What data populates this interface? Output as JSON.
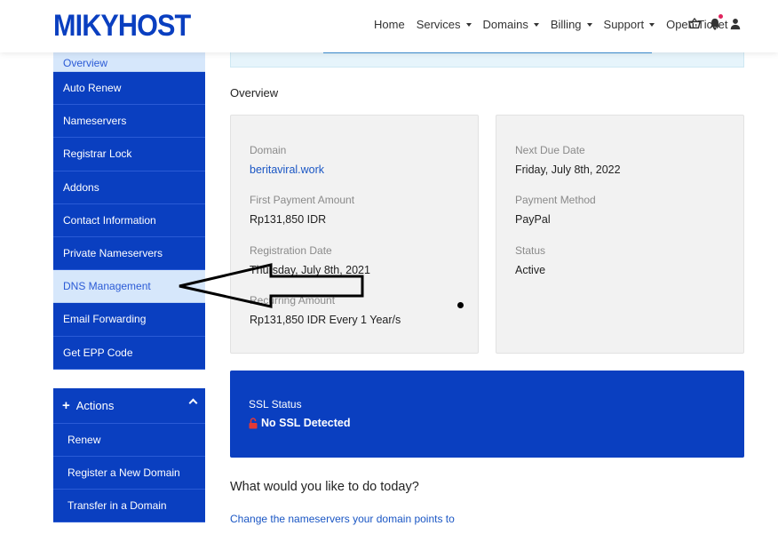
{
  "header": {
    "logo": "MIKYHOST",
    "nav": [
      {
        "label": "Home",
        "dropdown": false
      },
      {
        "label": "Services",
        "dropdown": true
      },
      {
        "label": "Domains",
        "dropdown": true
      },
      {
        "label": "Billing",
        "dropdown": true
      },
      {
        "label": "Support",
        "dropdown": true
      },
      {
        "label": "Open Ticket",
        "dropdown": false
      }
    ],
    "icons": [
      "cart-icon",
      "bell-icon",
      "user-icon"
    ]
  },
  "sidebar": {
    "items": [
      {
        "label": "Overview",
        "active": true
      },
      {
        "label": "Auto Renew",
        "active": false
      },
      {
        "label": "Nameservers",
        "active": false
      },
      {
        "label": "Registrar Lock",
        "active": false
      },
      {
        "label": "Addons",
        "active": false
      },
      {
        "label": "Contact Information",
        "active": false
      },
      {
        "label": "Private Nameservers",
        "active": false
      },
      {
        "label": "DNS Management",
        "active": true
      },
      {
        "label": "Email Forwarding",
        "active": false
      },
      {
        "label": "Get EPP Code",
        "active": false
      }
    ],
    "actions": {
      "title": "Actions",
      "items": [
        "Renew",
        "Register a New Domain",
        "Transfer in a Domain"
      ]
    }
  },
  "main": {
    "overview_title": "Overview",
    "left_card": [
      {
        "label": "Domain",
        "value": "beritaviral.work",
        "link": true
      },
      {
        "label": "First Payment Amount",
        "value": "Rp131,850 IDR"
      },
      {
        "label": "Registration Date",
        "value": "Thursday, July 8th, 2021"
      },
      {
        "label": "Recurring Amount",
        "value": "Rp131,850 IDR Every 1 Year/s"
      }
    ],
    "right_card": [
      {
        "label": "Next Due Date",
        "value": "Friday, July 8th, 2022"
      },
      {
        "label": "Payment Method",
        "value": "PayPal"
      },
      {
        "label": "Status",
        "value": "Active"
      }
    ],
    "ssl": {
      "label": "SSL Status",
      "value": "No SSL Detected"
    },
    "question": "What would you like to do today?",
    "change_link": "Change the nameservers your domain points to"
  },
  "colors": {
    "brand": "#0a3fc0",
    "active_bg": "#d6e7fb",
    "link": "#1a56c4"
  }
}
